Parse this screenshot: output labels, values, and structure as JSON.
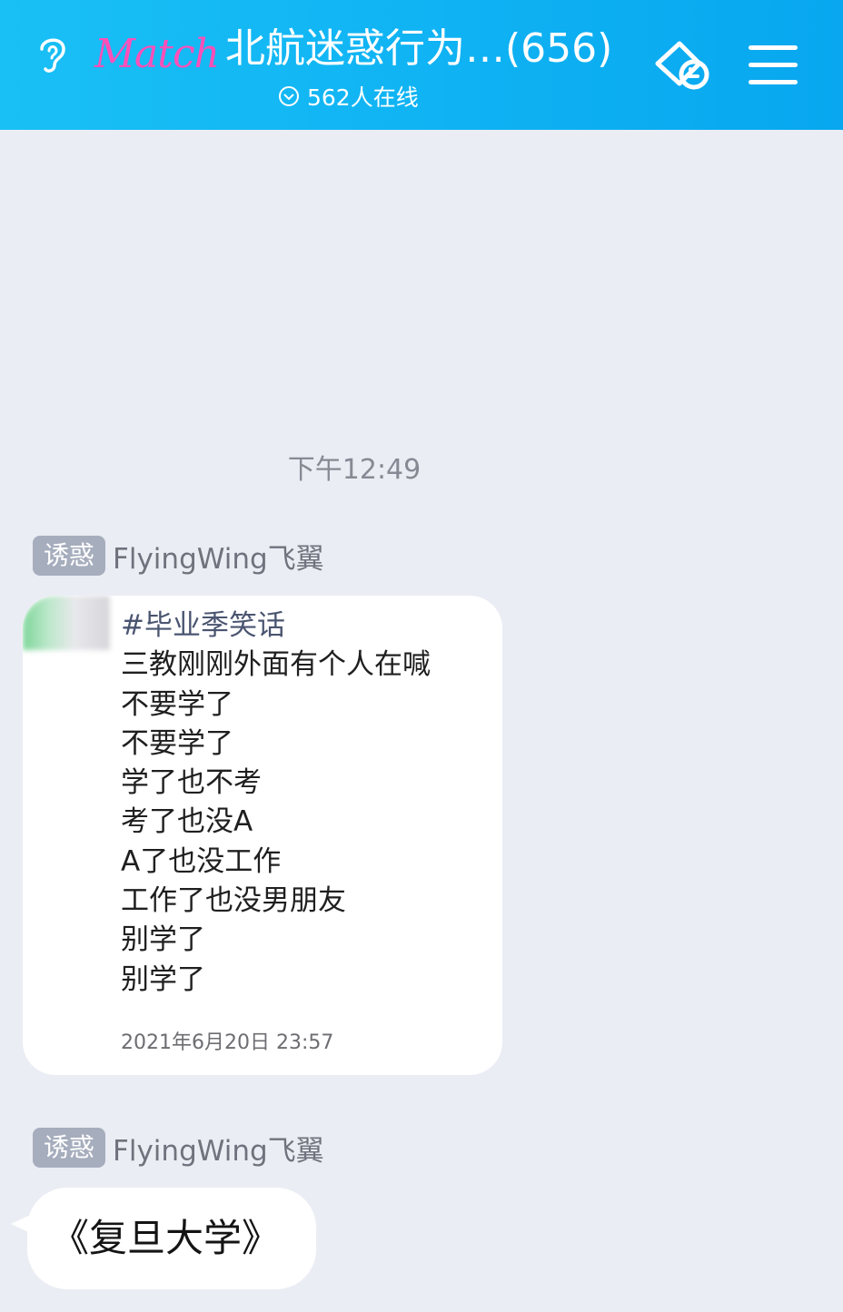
{
  "header": {
    "logo_text": "Match",
    "title": "北航迷惑行为…(656)",
    "online_text": "562人在线",
    "colors": {
      "bar": "#10b5f4",
      "logo": "#ff4fb8"
    },
    "icons": [
      "ear-icon",
      "check-circle-icon",
      "tag-icon",
      "menu-icon"
    ]
  },
  "chat": {
    "timestamp": "下午12:49",
    "messages": [
      {
        "badge": "诱惑",
        "sender": "FlyingWing飞翼",
        "hashtag": "#毕业季笑话",
        "lines": [
          "三教刚刚外面有个人在喊",
          "不要学了",
          "不要学了",
          "学了也不考",
          "考了也没A",
          "A了也没工作",
          "工作了也没男朋友",
          "别学了",
          "别学了"
        ],
        "date": "2021年6月20日 23:57"
      },
      {
        "badge": "诱惑",
        "sender": "FlyingWing飞翼",
        "text": "《复旦大学》"
      }
    ]
  }
}
